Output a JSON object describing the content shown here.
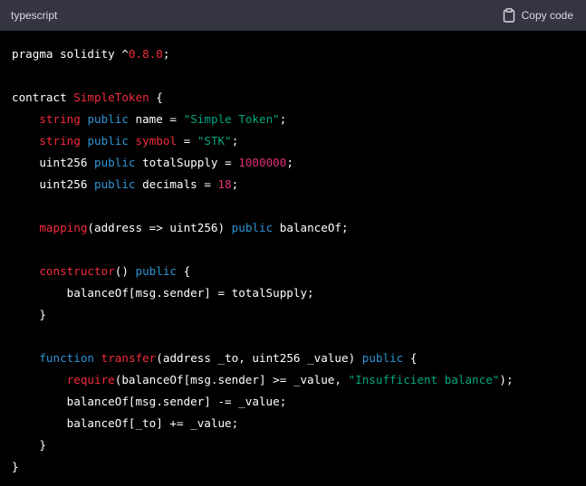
{
  "header": {
    "language": "typescript",
    "copy_label": "Copy code",
    "copy_icon": "clipboard-icon"
  },
  "colors": {
    "background": "#000000",
    "header_background": "#343541",
    "keyword": "#2e95d3",
    "type": "#f22c3d",
    "string": "#00a67d",
    "number": "#df3079",
    "plain": "#ffffff"
  },
  "code": {
    "lines": [
      [
        {
          "t": "pragma solidity ^",
          "c": "plain"
        },
        {
          "t": "0.8.0",
          "c": "type"
        },
        {
          "t": ";",
          "c": "plain"
        }
      ],
      [],
      [
        {
          "t": "contract ",
          "c": "plain"
        },
        {
          "t": "SimpleToken",
          "c": "type"
        },
        {
          "t": " {",
          "c": "plain"
        }
      ],
      [
        {
          "t": "    ",
          "c": "plain"
        },
        {
          "t": "string",
          "c": "fn"
        },
        {
          "t": " ",
          "c": "plain"
        },
        {
          "t": "public",
          "c": "kw"
        },
        {
          "t": " name = ",
          "c": "plain"
        },
        {
          "t": "\"Simple Token\"",
          "c": "str"
        },
        {
          "t": ";",
          "c": "plain"
        }
      ],
      [
        {
          "t": "    ",
          "c": "plain"
        },
        {
          "t": "string",
          "c": "fn"
        },
        {
          "t": " ",
          "c": "plain"
        },
        {
          "t": "public",
          "c": "kw"
        },
        {
          "t": " ",
          "c": "plain"
        },
        {
          "t": "symbol",
          "c": "fn"
        },
        {
          "t": " = ",
          "c": "plain"
        },
        {
          "t": "\"STK\"",
          "c": "str"
        },
        {
          "t": ";",
          "c": "plain"
        }
      ],
      [
        {
          "t": "    uint256 ",
          "c": "plain"
        },
        {
          "t": "public",
          "c": "kw"
        },
        {
          "t": " totalSupply = ",
          "c": "plain"
        },
        {
          "t": "1000000",
          "c": "num"
        },
        {
          "t": ";",
          "c": "plain"
        }
      ],
      [
        {
          "t": "    uint256 ",
          "c": "plain"
        },
        {
          "t": "public",
          "c": "kw"
        },
        {
          "t": " decimals = ",
          "c": "plain"
        },
        {
          "t": "18",
          "c": "num"
        },
        {
          "t": ";",
          "c": "plain"
        }
      ],
      [],
      [
        {
          "t": "    ",
          "c": "plain"
        },
        {
          "t": "mapping",
          "c": "fn"
        },
        {
          "t": "(address => uint256) ",
          "c": "plain"
        },
        {
          "t": "public",
          "c": "kw"
        },
        {
          "t": " balanceOf;",
          "c": "plain"
        }
      ],
      [],
      [
        {
          "t": "    ",
          "c": "plain"
        },
        {
          "t": "constructor",
          "c": "fn"
        },
        {
          "t": "() ",
          "c": "plain"
        },
        {
          "t": "public",
          "c": "kw"
        },
        {
          "t": " {",
          "c": "plain"
        }
      ],
      [
        {
          "t": "        balanceOf[msg.sender] = totalSupply;",
          "c": "plain"
        }
      ],
      [
        {
          "t": "    }",
          "c": "plain"
        }
      ],
      [],
      [
        {
          "t": "    ",
          "c": "plain"
        },
        {
          "t": "function",
          "c": "kw"
        },
        {
          "t": " ",
          "c": "plain"
        },
        {
          "t": "transfer",
          "c": "fn"
        },
        {
          "t": "(address _to, uint256 _value) ",
          "c": "plain"
        },
        {
          "t": "public",
          "c": "kw"
        },
        {
          "t": " {",
          "c": "plain"
        }
      ],
      [
        {
          "t": "        ",
          "c": "plain"
        },
        {
          "t": "require",
          "c": "fn"
        },
        {
          "t": "(balanceOf[msg.sender] >= _value, ",
          "c": "plain"
        },
        {
          "t": "\"Insufficient balance\"",
          "c": "str"
        },
        {
          "t": ");",
          "c": "plain"
        }
      ],
      [
        {
          "t": "        balanceOf[msg.sender] -= _value;",
          "c": "plain"
        }
      ],
      [
        {
          "t": "        balanceOf[_to] += _value;",
          "c": "plain"
        }
      ],
      [
        {
          "t": "    }",
          "c": "plain"
        }
      ],
      [
        {
          "t": "}",
          "c": "plain"
        }
      ]
    ]
  }
}
